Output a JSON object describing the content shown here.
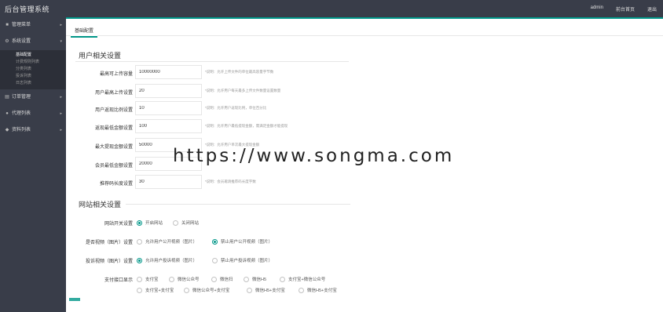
{
  "app": {
    "title": "后台管理系统"
  },
  "topbar": {
    "user": "admin",
    "site_link": "前台首页",
    "logout": "退出"
  },
  "sidebar": {
    "items": [
      {
        "label": "管理菜单",
        "icon": "home-icon"
      },
      {
        "label": "系统设置",
        "icon": "gear-icon"
      },
      {
        "label": "订单管理",
        "icon": "list-icon"
      },
      {
        "label": "代理列表",
        "icon": "user-icon"
      },
      {
        "label": "资料列表",
        "icon": "file-icon"
      }
    ],
    "sub_items": [
      "基础配置",
      "计费规则列表",
      "分类列表",
      "投诉列表",
      "日志列表"
    ]
  },
  "tab": {
    "label": "基础配置"
  },
  "user_section": {
    "title": "用户相关设置",
    "rows": [
      {
        "label": "最高可上传容量",
        "value": "10000000",
        "hint": "*说明：允许上传文件的单位最高容量字节数"
      },
      {
        "label": "用户最高上传设置",
        "value": "20",
        "hint": "*说明：允许用户每天最多上传文件数量设置数量"
      },
      {
        "label": "用户返现比例设置",
        "value": "10",
        "hint": "*说明：允许用户返现比例，单位百分比"
      },
      {
        "label": "返现最低金额设置",
        "value": "100",
        "hint": "*说明：允许用户最低提现金额，需满足金额才能提现"
      },
      {
        "label": "最大提现金额设置",
        "value": "50000",
        "hint": "*说明：允许用户单次最大提现金额"
      },
      {
        "label": "会员最低金额设置",
        "value": "20000",
        "hint": ""
      },
      {
        "label": "推荐码长度设置",
        "value": "30",
        "hint": "*说明：会员邀请推荐码长度字数"
      }
    ]
  },
  "site_section": {
    "title": "网站相关设置",
    "rows": [
      {
        "label": "网站开关设置",
        "options": [
          {
            "label": "开启网站",
            "checked": true
          },
          {
            "label": "关闭网站",
            "checked": false
          }
        ]
      },
      {
        "label": "是否视频（图片）设置",
        "options": [
          {
            "label": "允许用户公开视频（图片）",
            "checked": false
          },
          {
            "label": "禁止用户公开视频（图片）",
            "checked": true
          }
        ]
      },
      {
        "label": "投诉视频（图片）设置",
        "options": [
          {
            "label": "允许用户投诉视频（图片）",
            "checked": true
          },
          {
            "label": "禁止用户投诉视频（图片）",
            "checked": false
          }
        ]
      }
    ],
    "pay": {
      "label": "支付接口显示",
      "line1": [
        "支付宝",
        "微信公众号",
        "微信扫",
        "微信H5",
        "支付宝+微信公众号"
      ],
      "line2": [
        "支付宝+支付宝",
        "微信公众号+支付宝",
        "微信H5+支付宝",
        "微信H5+支付宝"
      ]
    }
  },
  "watermark": "https://www.songma.com",
  "colors": {
    "accent": "#009688",
    "header_bg": "#393d49"
  }
}
